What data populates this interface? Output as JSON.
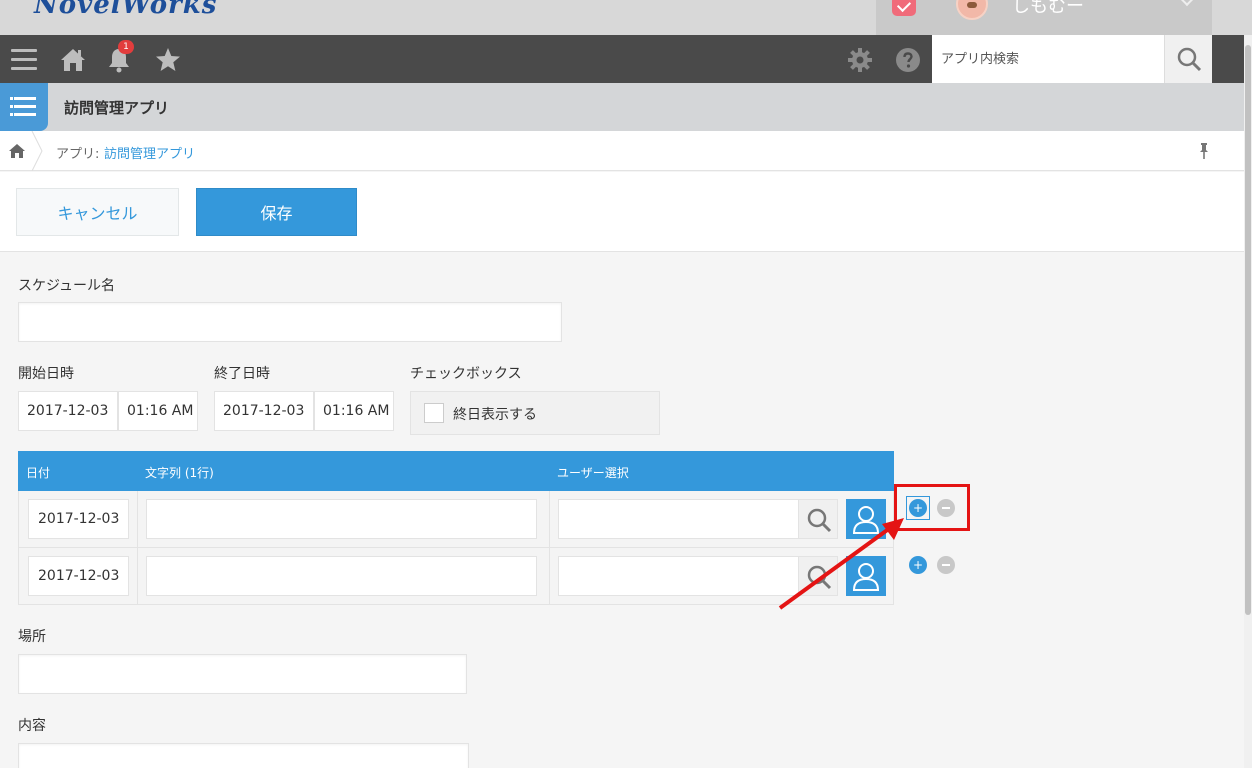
{
  "brand": {
    "logo_text": "NovelWorks",
    "user_name": "しもむー"
  },
  "nav": {
    "notification_count": "1",
    "search_placeholder": "アプリ内検索"
  },
  "app": {
    "title": "訪問管理アプリ"
  },
  "breadcrumb": {
    "prefix": "アプリ:",
    "link": "訪問管理アプリ"
  },
  "actions": {
    "cancel_label": "キャンセル",
    "save_label": "保存"
  },
  "form": {
    "schedule_name_label": "スケジュール名",
    "start_label": "開始日時",
    "start_date": "2017-12-03",
    "start_time": "01:16 AM",
    "end_label": "終了日時",
    "end_date": "2017-12-03",
    "end_time": "01:16 AM",
    "checkbox_group_label": "チェックボックス",
    "checkbox_option": "終日表示する",
    "table": {
      "headers": [
        "日付",
        "文字列 (1行)",
        "ユーザー選択"
      ],
      "rows": [
        {
          "date": "2017-12-03"
        },
        {
          "date": "2017-12-03"
        }
      ]
    },
    "location_label": "場所",
    "content_label": "内容"
  },
  "colors": {
    "accent": "#3498db",
    "nav_bg": "#4a4a4a",
    "annotation_red": "#e41414"
  }
}
